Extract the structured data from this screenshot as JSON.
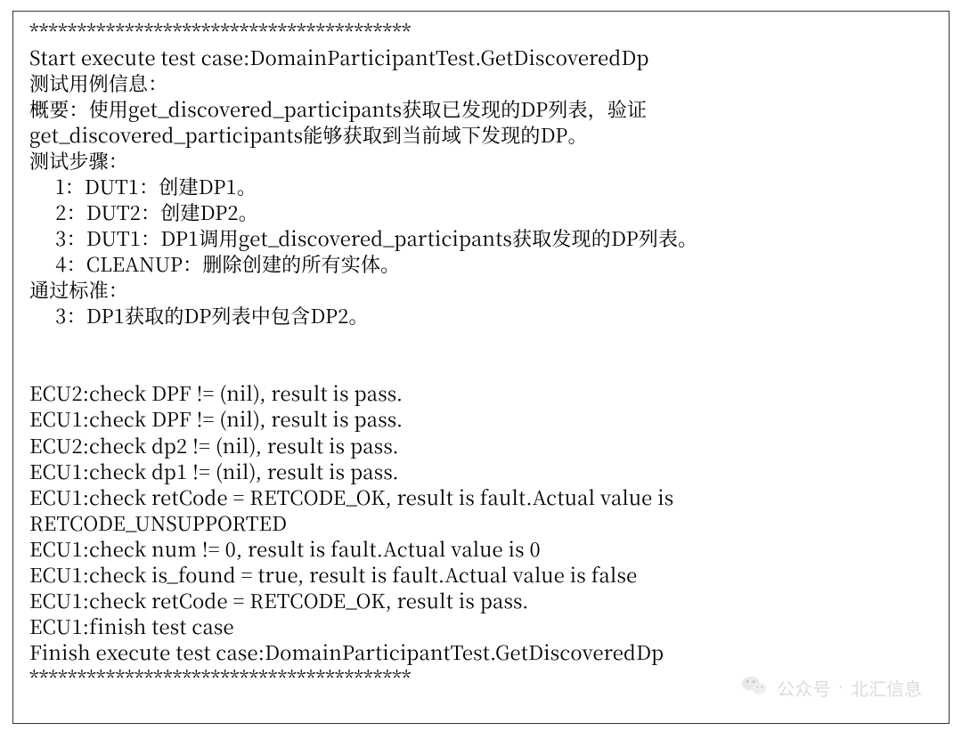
{
  "log": {
    "separatorTop": "****************************************",
    "startLine": "Start execute test case:DomainParticipantTest.GetDiscoveredDp",
    "infoHeader": "测试用例信息：",
    "summary1": "概要：使用get_discovered_participants获取已发现的DP列表，验证",
    "summary2": "get_discovered_participants能够获取到当前域下发现的DP。",
    "stepsHeader": "测试步骤：",
    "step1": "     1：DUT1：创建DP1。",
    "step2": "     2：DUT2：创建DP2。",
    "step3": "     3：DUT1：DP1调用get_discovered_participants获取发现的DP列表。",
    "step4": "     4：CLEANUP：删除创建的所有实体。",
    "passHeader": "通过标准：",
    "passCriteria": "     3：DP1获取的DP列表中包含DP2。",
    "blank1": "",
    "blank2": "",
    "check1": "ECU2:check DPF != (nil), result is pass.",
    "check2": "ECU1:check DPF != (nil), result is pass.",
    "check3": "ECU2:check dp2 != (nil), result is pass.",
    "check4": "ECU1:check dp1 != (nil), result is pass.",
    "check5a": "ECU1:check retCode = RETCODE_OK, result is fault.Actual value is",
    "check5b": "RETCODE_UNSUPPORTED",
    "check6": "ECU1:check num != 0, result is fault.Actual value is 0",
    "check7": "ECU1:check is_found = true, result is fault.Actual value is false",
    "check8": "ECU1:check retCode = RETCODE_OK, result is pass.",
    "finish1": "ECU1:finish test case",
    "finish2": "Finish execute test case:DomainParticipantTest.GetDiscoveredDp",
    "separatorBottom": "****************************************"
  },
  "watermark": {
    "label": "公众号",
    "separator": "·",
    "source": "北汇信息"
  }
}
